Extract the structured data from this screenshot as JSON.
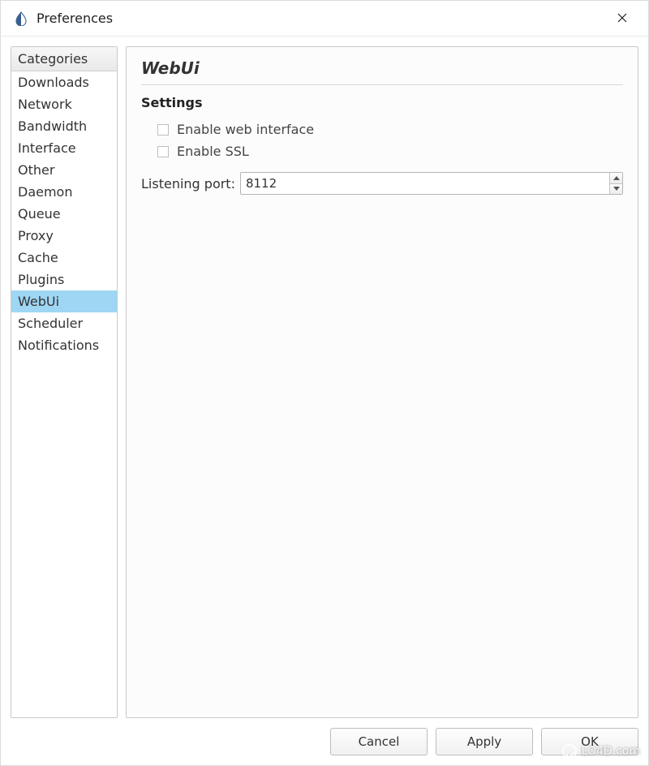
{
  "window": {
    "title": "Preferences"
  },
  "sidebar": {
    "header": "Categories",
    "items": [
      {
        "label": "Downloads"
      },
      {
        "label": "Network"
      },
      {
        "label": "Bandwidth"
      },
      {
        "label": "Interface"
      },
      {
        "label": "Other"
      },
      {
        "label": "Daemon"
      },
      {
        "label": "Queue"
      },
      {
        "label": "Proxy"
      },
      {
        "label": "Cache"
      },
      {
        "label": "Plugins"
      },
      {
        "label": "WebUi",
        "selected": true
      },
      {
        "label": "Scheduler"
      },
      {
        "label": "Notifications"
      }
    ]
  },
  "panel": {
    "title": "WebUi",
    "section": "Settings",
    "checkboxes": {
      "enable_web": "Enable web interface",
      "enable_ssl": "Enable SSL"
    },
    "port": {
      "label": "Listening port:",
      "value": "8112"
    }
  },
  "buttons": {
    "cancel": "Cancel",
    "apply": "Apply",
    "ok": "OK"
  },
  "watermark": "LO4D.com"
}
